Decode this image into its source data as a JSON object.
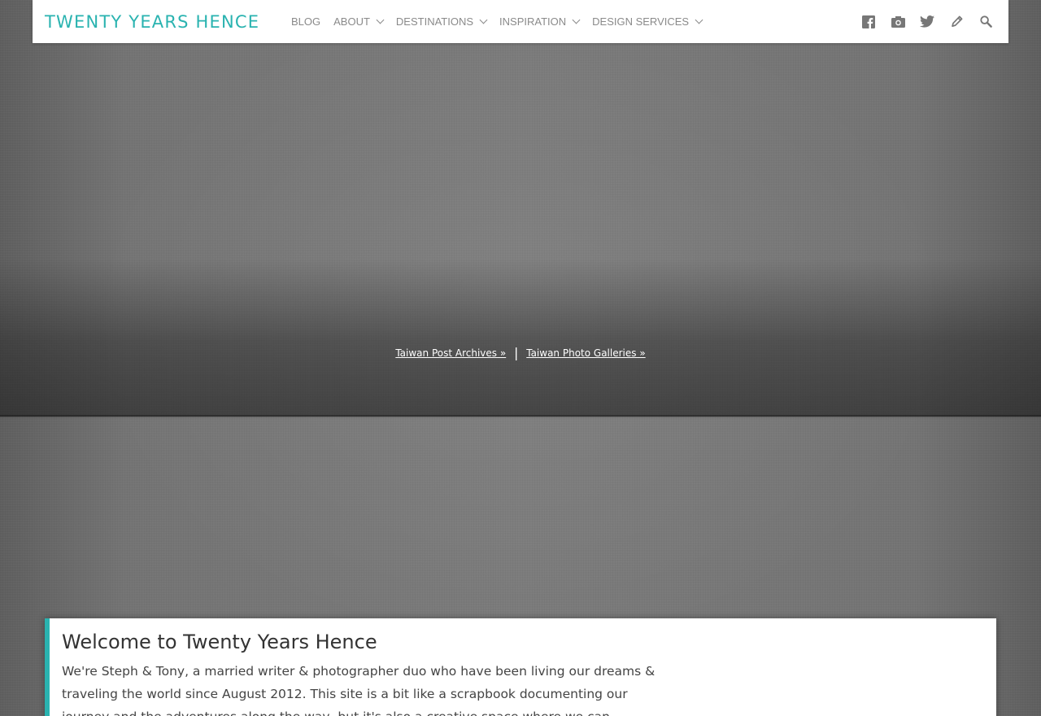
{
  "site": {
    "logo": "TWENTY YEARS HENCE",
    "accent_color": "#2ab3b0"
  },
  "nav": {
    "items": [
      {
        "label": "BLOG",
        "has_dropdown": false
      },
      {
        "label": "ABOUT",
        "has_dropdown": true
      },
      {
        "label": "DESTINATIONS",
        "has_dropdown": true
      },
      {
        "label": "INSPIRATION",
        "has_dropdown": true
      },
      {
        "label": "DESIGN SERVICES",
        "has_dropdown": true
      }
    ],
    "icons": [
      "facebook-icon",
      "instagram-camera-icon",
      "twitter-icon",
      "pencil-icon",
      "search-icon"
    ]
  },
  "hero": {
    "archive_link": "Taiwan Post Archives »",
    "separator": "|",
    "gallery_link": "Taiwan Photo Galleries »"
  },
  "welcome": {
    "title": "Welcome to Twenty Years Hence",
    "body": "We're Steph & Tony, a married writer & photographer duo who have been living our dreams & traveling the world since August 2012. This site is a bit like a scrapbook documenting our journey and the adventures along the way, but it's also a creative space where we can explore the art of"
  }
}
